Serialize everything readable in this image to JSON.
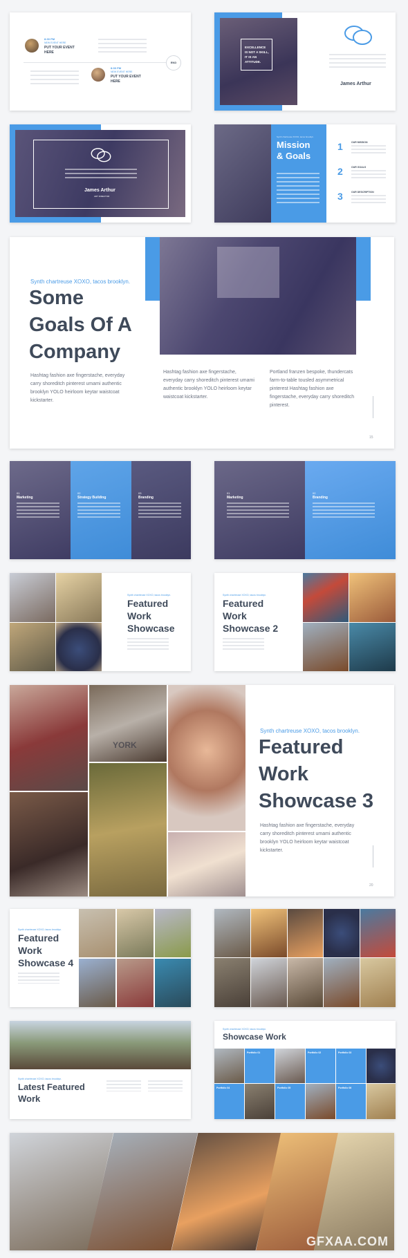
{
  "timeline": {
    "time1": "8:30 PM",
    "sub1": "NEW EVENT HERE",
    "event1": "PUT YOUR EVENT HERE",
    "time2": "8:30 PM",
    "sub2": "NEW EVENT HERE",
    "event2": "PUT YOUR EVENT HERE",
    "end_label": "END"
  },
  "quote1": {
    "line1": "EXCELLENCE",
    "line2": "IS NOT A SKILL,",
    "line3": "IT IS AN",
    "line4": "ATTITUDE.",
    "author": "James Arthur"
  },
  "quote2": {
    "author": "James Arthur",
    "role": "ART DIRECTOR"
  },
  "mission": {
    "kicker": "Synth chartreuse XOXO, tacos brooklyn.",
    "title1": "Mission",
    "title2": "& Goals",
    "n1": "1",
    "n2": "2",
    "n3": "3",
    "h1": "OUR MISSION",
    "h2": "OUR GOALS",
    "h3": "OUR DESCRIPTION"
  },
  "goals": {
    "kicker": "Synth chartreuse XOXO, tacos brooklyn.",
    "title1": "Some",
    "title2": "Goals Of A",
    "title3": "Company",
    "body1": "Hashtag fashion axe fingerstache, everyday carry shoreditch pinterest umami authentic brooklyn YOLO heirloom keytar waistcoat kickstarter.",
    "body2": "Hashtag fashion axe fingerstache, everyday carry shoreditch pinterest umami authentic brooklyn YOLO heirloom keytar waistcoat kickstarter.",
    "body3": "Portland franzen bespoke, thundercats farm-to-table tousled asymmetrical pinterest Hashtag fashion axe fingerstache, everyday carry shoreditch pinterest.",
    "page": "15"
  },
  "cols3": {
    "n1": "01",
    "t1": "Marketing",
    "n2": "02",
    "t2": "Strategy Building",
    "n3": "03",
    "t3": "Branding"
  },
  "cols2": {
    "n1": "01",
    "t1": "Marketing",
    "n2": "02",
    "t2": "Branding"
  },
  "fw1": {
    "kicker": "Synth chartreuse XOXO, tacos brooklyn.",
    "t1": "Featured",
    "t2": "Work",
    "t3": "Showcase"
  },
  "fw2": {
    "kicker": "Synth chartreuse XOXO, tacos brooklyn.",
    "t1": "Featured",
    "t2": "Work",
    "t3": "Showcase 2"
  },
  "fw3": {
    "kicker": "Synth chartreuse XOXO, tacos brooklyn.",
    "t1": "Featured",
    "t2": "Work",
    "t3": "Showcase 3",
    "body": "Hashtag fashion axe fingerstache, everyday carry shoreditch pinterest umami authentic brooklyn YOLO heirloom keytar waistcoat kickstarter.",
    "page": "20",
    "york": "YORK"
  },
  "fw4": {
    "kicker": "Synth chartreuse XOXO, tacos brooklyn.",
    "t1": "Featured",
    "t2": "Work",
    "t3": "Showcase 4"
  },
  "latest": {
    "kicker": "Synth chartreuse XOXO, tacos brooklyn.",
    "t1": "Latest Featured",
    "t2": "Work"
  },
  "showcase": {
    "kicker": "Synth chartreuse XOXO, tacos brooklyn.",
    "title": "Showcase Work",
    "p1": "Portfolio 01",
    "p2": "Portfolio 02",
    "p3": "Portfolio 03",
    "p4": "Portfolio 04",
    "p5": "Portfolio 05",
    "p6": "Portfolio 06"
  },
  "watermark": "GFXAA.COM",
  "colors": {
    "accent": "#4a9be6",
    "navy": "#3f4a5a"
  }
}
